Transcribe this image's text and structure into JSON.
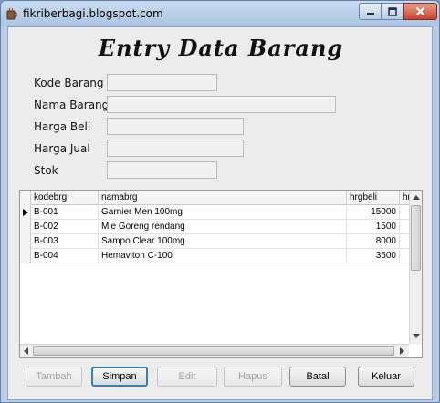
{
  "window": {
    "title": "fikriberbagi.blogspot.com"
  },
  "form": {
    "heading": "Entry Data Barang",
    "fields": [
      {
        "label": "Kode Barang",
        "value": ""
      },
      {
        "label": "Nama Barang",
        "value": ""
      },
      {
        "label": "Harga Beli",
        "value": ""
      },
      {
        "label": "Harga Jual",
        "value": ""
      },
      {
        "label": "Stok",
        "value": ""
      }
    ]
  },
  "table": {
    "columns": [
      "kodebrg",
      "namabrg",
      "hrgbeli",
      "hr"
    ],
    "rows": [
      {
        "kodebrg": "B-001",
        "namabrg": "Garnier Men 100mg",
        "hrgbeli": "15000"
      },
      {
        "kodebrg": "B-002",
        "namabrg": "Mie Goreng rendang",
        "hrgbeli": "1500"
      },
      {
        "kodebrg": "B-003",
        "namabrg": "Sampo Clear 100mg",
        "hrgbeli": "8000"
      },
      {
        "kodebrg": "B-004",
        "namabrg": "Hemaviton C-100",
        "hrgbeli": "3500"
      }
    ],
    "selected_row": 0
  },
  "buttons": {
    "tambah": "Tambah",
    "simpan": "Simpan",
    "edit": "Edit",
    "hapus": "Hapus",
    "batal": "Batal",
    "keluar": "Keluar"
  },
  "icons": {
    "app": "coffee-cup-icon",
    "minimize": "minimize-icon",
    "maximize": "maximize-icon",
    "close": "close-icon"
  },
  "colors": {
    "titlebar": "#b7cde6",
    "close_button": "#c7452b",
    "focus_border": "#3c7fb1"
  }
}
